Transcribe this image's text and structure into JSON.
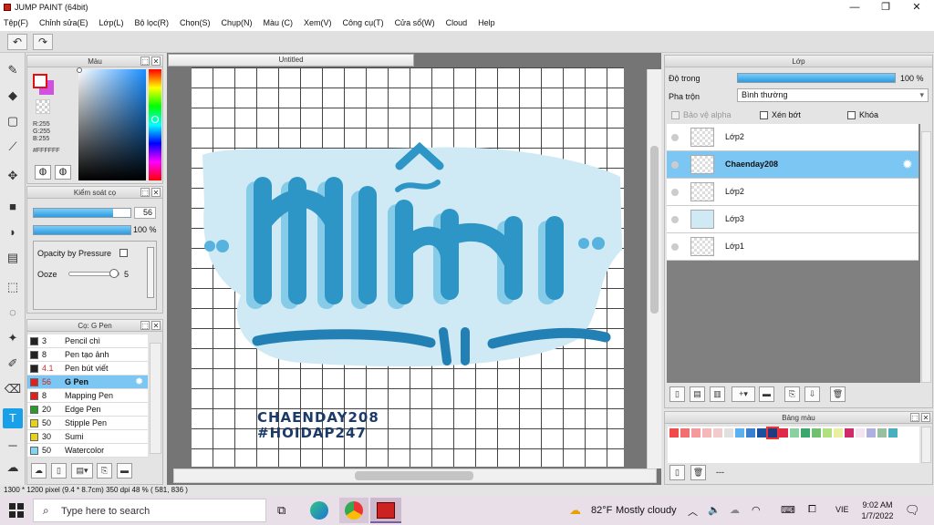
{
  "window": {
    "title": "JUMP PAINT (64bit)",
    "min": "—",
    "max": "❐",
    "close": "✕"
  },
  "menu": [
    "Tệp(F)",
    "Chỉnh sửa(E)",
    "Lớp(L)",
    "Bộ lọc(R)",
    "Chọn(S)",
    "Chụp(N)",
    "Màu (C)",
    "Xem(V)",
    "Công cụ(T)",
    "Cửa sổ(W)",
    "Cloud",
    "Help"
  ],
  "toolbar": {
    "undo": "↶",
    "redo": "↷"
  },
  "color_panel": {
    "title": "Màu",
    "r": "R:255",
    "g": "G:255",
    "b": "B:255",
    "hex": "#FFFFFF",
    "fg": "#ffffff",
    "bg": "#d050e0"
  },
  "brush_control": {
    "title": "Kiểm soát cọ",
    "size": "56",
    "opacity": "100 %",
    "opacity_pressure": "Opacity by Pressure",
    "ooze_label": "Ooze",
    "ooze_value": "5",
    "size_level": 0.82,
    "opacity_level": 1.0,
    "ooze_level": 0.95
  },
  "brush_panel": {
    "title": "Cọ: G Pen",
    "items": [
      {
        "size": "3",
        "name": "Pencil chì",
        "color": "#222222"
      },
      {
        "size": "8",
        "name": "Pen tạo ảnh",
        "color": "#222222"
      },
      {
        "size": "4.1",
        "name": "Pen bút viết",
        "color": "#222222"
      },
      {
        "size": "56",
        "name": "G Pen",
        "color": "#e02020"
      },
      {
        "size": "8",
        "name": "Mapping Pen",
        "color": "#e02020"
      },
      {
        "size": "20",
        "name": "Edge Pen",
        "color": "#2a9a2a"
      },
      {
        "size": "50",
        "name": "Stipple Pen",
        "color": "#e6d21a"
      },
      {
        "size": "30",
        "name": "Sumi",
        "color": "#e6d21a"
      },
      {
        "size": "50",
        "name": "Watercolor",
        "color": "#7fd6f2"
      }
    ]
  },
  "canvas": {
    "tab": "Untitled",
    "text_line1": "CHAENDAY208",
    "text_line2": "#HOIDAP247"
  },
  "layer_panel": {
    "title": "Lớp",
    "opacity_label": "Độ trong",
    "opacity_value": "100 %",
    "opacity_level": 1.0,
    "blend_label": "Pha trộn",
    "blend_value": "Bình thường",
    "protect_alpha": "Bảo vệ alpha",
    "clipping": "Xén bớt",
    "lock": "Khóa",
    "layers": [
      {
        "name": "Lớp2",
        "selected": false
      },
      {
        "name": "Chaenday208",
        "selected": true
      },
      {
        "name": "Lớp2",
        "selected": false
      },
      {
        "name": "Lớp3",
        "selected": false
      },
      {
        "name": "Lớp1",
        "selected": false
      }
    ]
  },
  "palette_panel": {
    "title": "Bảng màu",
    "colors": [
      "#f24a4a",
      "#f07070",
      "#f49a9a",
      "#f4b8b8",
      "#f2cccc",
      "#e0e0e0",
      "#5ab0f0",
      "#3a80d0",
      "#1a50a0",
      "#203a80",
      "#e02a4a",
      "#8ad0a0",
      "#3aa86a",
      "#70c070",
      "#b0e080",
      "#e8f0a0",
      "#d02a6a",
      "#f2e4f0",
      "#b0b0e0",
      "#98c0a0",
      "#4ab0c0"
    ],
    "more": "---"
  },
  "status": {
    "text": "1300 * 1200 pixel   (9.4 * 8.7cm)   350 dpi   48 %   ( 581, 836 )"
  },
  "taskbar": {
    "search_placeholder": "Type here to search",
    "weather_temp": "82°F",
    "weather_text": "Mostly cloudy",
    "lang": "VIE",
    "time": "9:02 AM",
    "date": "1/7/2022"
  }
}
